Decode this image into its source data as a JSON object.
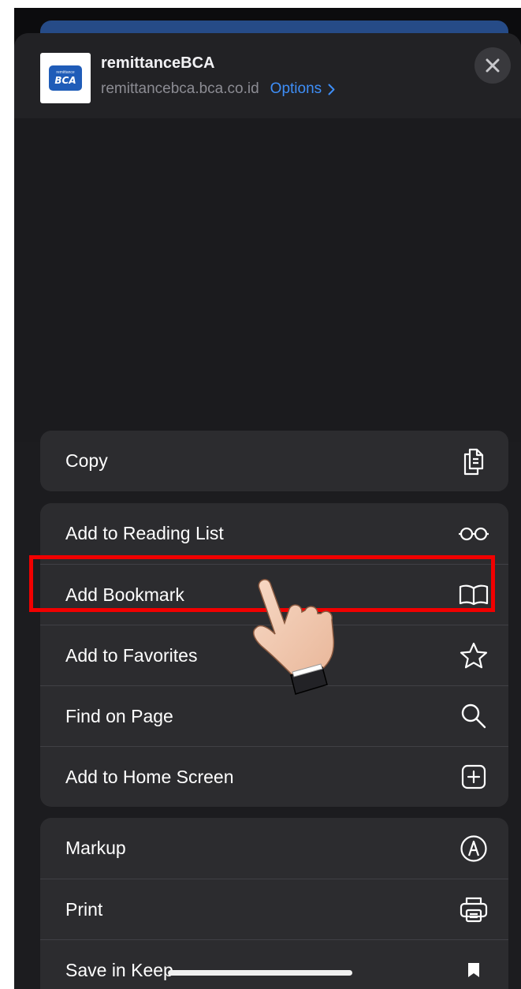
{
  "header": {
    "site_title": "remittanceBCA",
    "site_url": "remittancebca.bca.co.id",
    "options_label": "Options",
    "options_chevron": "chevron-right-icon",
    "close_icon": "close-icon",
    "site_icon": {
      "small_text": "remittance",
      "big_text": "BCA"
    }
  },
  "menu": {
    "group1": [
      {
        "label": "Copy",
        "icon": "copy-icon"
      }
    ],
    "group2": [
      {
        "label": "Add to Reading List",
        "icon": "glasses-icon"
      },
      {
        "label": "Add Bookmark",
        "icon": "book-icon",
        "highlighted": true
      },
      {
        "label": "Add to Favorites",
        "icon": "star-icon"
      },
      {
        "label": "Find on Page",
        "icon": "magnifier-icon"
      },
      {
        "label": "Add to Home Screen",
        "icon": "plus-square-icon"
      }
    ],
    "group3": [
      {
        "label": "Markup",
        "icon": "markup-icon"
      },
      {
        "label": "Print",
        "icon": "printer-icon"
      },
      {
        "label": "Save in Keep",
        "icon": "bookmark-icon"
      }
    ]
  },
  "colors": {
    "accent": "#3e8ef7",
    "highlight": "#f10000",
    "sheet_bg": "#1c1c1f",
    "row_bg": "#2c2c2f"
  }
}
